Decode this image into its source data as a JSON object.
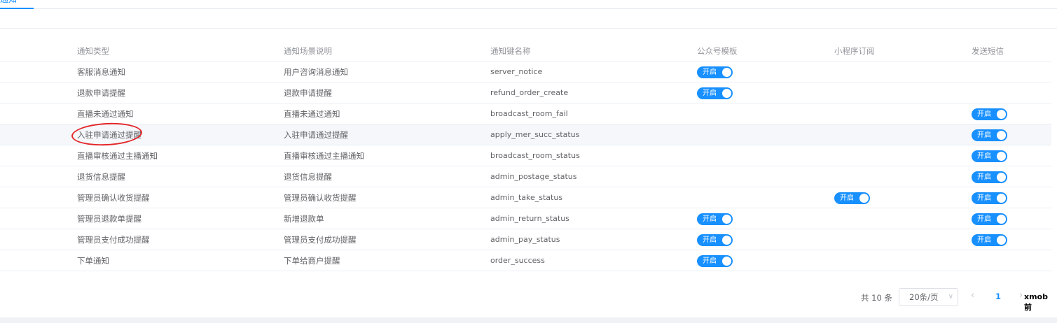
{
  "tabs": {
    "active_label": "通知"
  },
  "table": {
    "headers": [
      "通知类型",
      "通知场景说明",
      "通知键名称",
      "公众号模板",
      "小程序订阅",
      "发送短信"
    ],
    "switch_label": "开启",
    "rows": [
      {
        "type": "客服消息通知",
        "desc": "用户咨询消息通知",
        "key": "server_notice",
        "wechat": true,
        "mini": false,
        "sms": false
      },
      {
        "type": "退款申请提醒",
        "desc": "退款申请提醒",
        "key": "refund_order_create",
        "wechat": true,
        "mini": false,
        "sms": false
      },
      {
        "type": "直播未通过通知",
        "desc": "直播未通过通知",
        "key": "broadcast_room_fail",
        "wechat": false,
        "mini": false,
        "sms": true
      },
      {
        "type": "入驻申请通过提醒",
        "desc": "入驻申请通过提醒",
        "key": "apply_mer_succ_status",
        "wechat": false,
        "mini": false,
        "sms": true
      },
      {
        "type": "直播审核通过主播通知",
        "desc": "直播审核通过主播通知",
        "key": "broadcast_room_status",
        "wechat": false,
        "mini": false,
        "sms": true
      },
      {
        "type": "退货信息提醒",
        "desc": "退货信息提醒",
        "key": "admin_postage_status",
        "wechat": false,
        "mini": false,
        "sms": true
      },
      {
        "type": "管理员确认收货提醒",
        "desc": "管理员确认收货提醒",
        "key": "admin_take_status",
        "wechat": false,
        "mini": true,
        "sms": true
      },
      {
        "type": "管理员退款单提醒",
        "desc": "新增退款单",
        "key": "admin_return_status",
        "wechat": true,
        "mini": false,
        "sms": true
      },
      {
        "type": "管理员支付成功提醒",
        "desc": "管理员支付成功提醒",
        "key": "admin_pay_status",
        "wechat": true,
        "mini": false,
        "sms": true
      },
      {
        "type": "下单通知",
        "desc": "下单给商户提醒",
        "key": "order_success",
        "wechat": true,
        "mini": false,
        "sms": false
      }
    ]
  },
  "pagination": {
    "total_text": "共 10 条",
    "page_size": "20条/页",
    "prev_icon": "‹",
    "current_page": "1",
    "next_icon": "›"
  },
  "watermark": "xmob 前",
  "colors": {
    "primary": "#1890ff",
    "highlight": "#e4262a"
  }
}
